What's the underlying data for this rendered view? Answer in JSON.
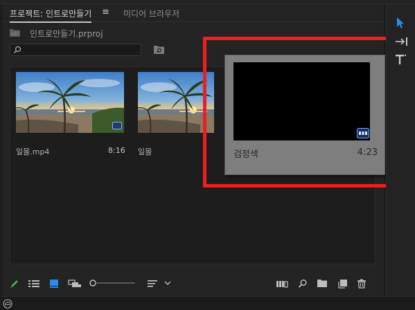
{
  "tabs": {
    "active_label": "프로젝트: 인트로만들기",
    "menu_glyph": "≡",
    "inactive_label": "미디어 브라우저"
  },
  "project": {
    "file_name": "인트로만들기.prproj"
  },
  "search": {
    "placeholder": ""
  },
  "clips": [
    {
      "name": "일몰.mp4",
      "duration": "8:16",
      "thumbnail": "sunset-palm-beach"
    },
    {
      "name": "일몰",
      "duration": "",
      "thumbnail": "sunset-palm-beach"
    }
  ],
  "drag_card": {
    "name": "검정색",
    "duration": "4:23"
  },
  "icons": {
    "bottom_left": [
      "pencil-icon",
      "list-view-icon",
      "icon-view-icon",
      "freeform-view-icon",
      "zoom-slider",
      "sort-icon",
      "chevron-down-icon"
    ],
    "bottom_right": [
      "automate-to-sequence-icon",
      "find-icon",
      "new-bin-icon",
      "new-item-icon",
      "trash-icon"
    ],
    "tools": [
      "selection-tool-icon",
      "track-select-tool-icon",
      "type-tool-icon"
    ],
    "status": "creative-cloud-icon"
  },
  "colors": {
    "highlight_border": "#ee1f1f",
    "accent_blue": "#2d8ceb",
    "pencil_green": "#3fb54a",
    "panel_bg": "#232323"
  }
}
